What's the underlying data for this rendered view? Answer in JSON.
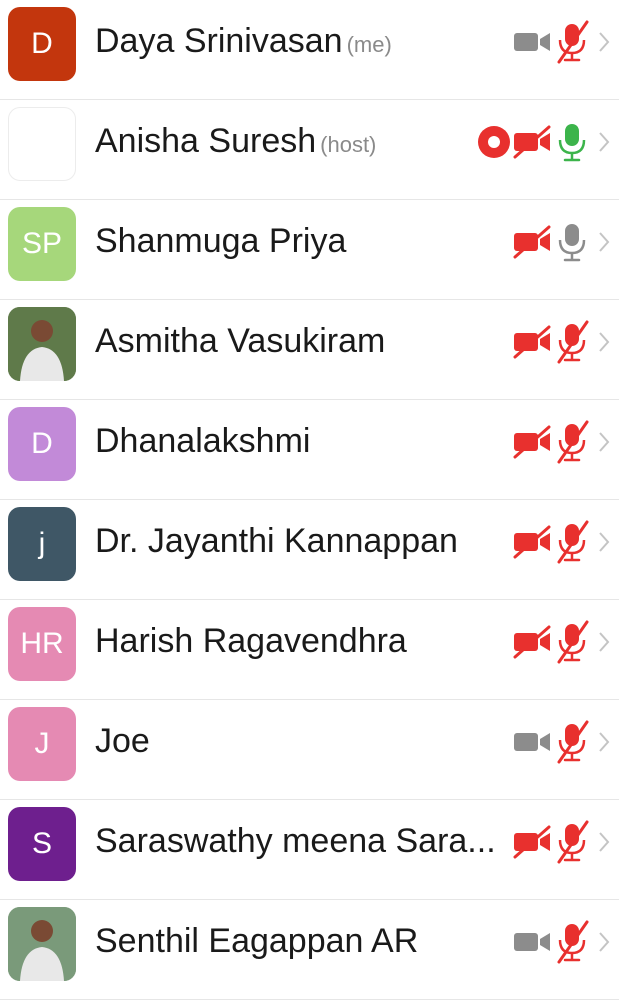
{
  "participants": [
    {
      "name": "Daya Srinivasan",
      "tag": "(me)",
      "initials": "D",
      "avatar_color": "#c3360d",
      "avatar_kind": "initials",
      "video": "on",
      "mic": "muted",
      "recording": false
    },
    {
      "name": "Anisha Suresh",
      "tag": "(host)",
      "initials": "",
      "avatar_color": "#ffffff",
      "avatar_kind": "blank",
      "video": "off",
      "mic": "active",
      "recording": true
    },
    {
      "name": "Shanmuga Priya",
      "tag": "",
      "initials": "SP",
      "avatar_color": "#a6d77b",
      "avatar_kind": "initials",
      "video": "off",
      "mic": "on",
      "recording": false
    },
    {
      "name": "Asmitha Vasukiram",
      "tag": "",
      "initials": "",
      "avatar_color": "#5f7a4a",
      "avatar_kind": "photo",
      "video": "off",
      "mic": "muted",
      "recording": false
    },
    {
      "name": "Dhanalakshmi",
      "tag": "",
      "initials": "D",
      "avatar_color": "#c28ad8",
      "avatar_kind": "initials",
      "video": "off",
      "mic": "muted",
      "recording": false
    },
    {
      "name": "Dr. Jayanthi Kannappan",
      "tag": "",
      "initials": "j",
      "avatar_color": "#3f5766",
      "avatar_kind": "initials",
      "video": "off",
      "mic": "muted",
      "recording": false
    },
    {
      "name": "Harish Ragavendhra",
      "tag": "",
      "initials": "HR",
      "avatar_color": "#e58ab3",
      "avatar_kind": "initials",
      "video": "off",
      "mic": "muted",
      "recording": false
    },
    {
      "name": "Joe",
      "tag": "",
      "initials": "J",
      "avatar_color": "#e58ab3",
      "avatar_kind": "initials",
      "video": "on",
      "mic": "muted",
      "recording": false
    },
    {
      "name": "Saraswathy meena Sara...",
      "tag": "",
      "initials": "S",
      "avatar_color": "#6e1f8e",
      "avatar_kind": "initials",
      "video": "off",
      "mic": "muted",
      "recording": false
    },
    {
      "name": "Senthil Eagappan AR",
      "tag": "",
      "initials": "",
      "avatar_color": "#7a9a7a",
      "avatar_kind": "photo",
      "video": "on",
      "mic": "muted",
      "recording": false
    }
  ],
  "colors": {
    "muted_red": "#e8302e",
    "icon_gray": "#8c8c8c",
    "active_green": "#3cb44b",
    "chevron": "#c4c4c4"
  },
  "icons": {
    "video_on": "video-camera-icon",
    "video_off": "video-camera-off-icon",
    "mic_on": "microphone-icon",
    "mic_off": "microphone-muted-icon",
    "recording": "recording-icon",
    "chevron": "chevron-right-icon"
  }
}
